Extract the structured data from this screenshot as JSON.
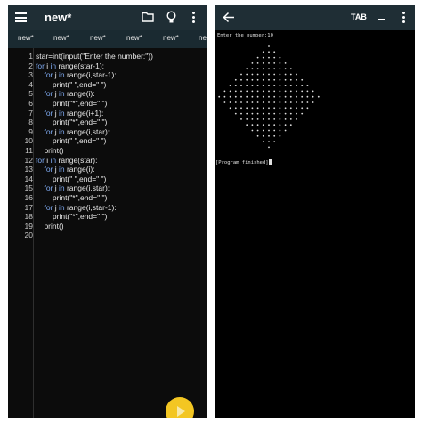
{
  "editor": {
    "title": "new*",
    "tabs": [
      "new*",
      "new*",
      "new*",
      "new*",
      "new*",
      "ne"
    ],
    "line_numbers": [
      "1",
      "2",
      "3",
      "4",
      "5",
      "6",
      "7",
      "8",
      "9",
      "10",
      "11",
      "12",
      "13",
      "14",
      "15",
      "16",
      "17",
      "18",
      "19",
      "20"
    ],
    "code_lines": [
      {
        "segs": [
          {
            "t": "star=int(input(\"Enter the number:\"))"
          }
        ]
      },
      {
        "segs": [
          {
            "t": "for ",
            "k": 1
          },
          {
            "t": "i "
          },
          {
            "t": "in ",
            "k": 1
          },
          {
            "t": "range(star-1):"
          }
        ]
      },
      {
        "segs": [
          {
            "t": "    "
          },
          {
            "t": "for ",
            "k": 1
          },
          {
            "t": "j "
          },
          {
            "t": "in ",
            "k": 1
          },
          {
            "t": "range(i,star-1):"
          }
        ]
      },
      {
        "segs": [
          {
            "t": "        print(\" \",end=\" \")"
          }
        ]
      },
      {
        "segs": [
          {
            "t": "    "
          },
          {
            "t": "for ",
            "k": 1
          },
          {
            "t": "j "
          },
          {
            "t": "in ",
            "k": 1
          },
          {
            "t": "range(i):"
          }
        ]
      },
      {
        "segs": [
          {
            "t": "        print(\"*\",end=\" \")"
          }
        ]
      },
      {
        "segs": [
          {
            "t": "    "
          },
          {
            "t": "for ",
            "k": 1
          },
          {
            "t": "j "
          },
          {
            "t": "in ",
            "k": 1
          },
          {
            "t": "range(i+1):"
          }
        ]
      },
      {
        "segs": [
          {
            "t": "        print(\"*\",end=\" \")"
          }
        ]
      },
      {
        "segs": [
          {
            "t": "    "
          },
          {
            "t": "for ",
            "k": 1
          },
          {
            "t": "j "
          },
          {
            "t": "in ",
            "k": 1
          },
          {
            "t": "range(i,star):"
          }
        ]
      },
      {
        "segs": [
          {
            "t": "        print(\" \",end=\" \")"
          }
        ]
      },
      {
        "segs": [
          {
            "t": "    print()"
          }
        ]
      },
      {
        "segs": [
          {
            "t": "for ",
            "k": 1
          },
          {
            "t": "i "
          },
          {
            "t": "in ",
            "k": 1
          },
          {
            "t": "range(star):"
          }
        ]
      },
      {
        "segs": [
          {
            "t": "    "
          },
          {
            "t": "for ",
            "k": 1
          },
          {
            "t": "j "
          },
          {
            "t": "in ",
            "k": 1
          },
          {
            "t": "range(i):"
          }
        ]
      },
      {
        "segs": [
          {
            "t": "        print(\" \",end=\" \")"
          }
        ]
      },
      {
        "segs": [
          {
            "t": "    "
          },
          {
            "t": "for ",
            "k": 1
          },
          {
            "t": "j "
          },
          {
            "t": "in ",
            "k": 1
          },
          {
            "t": "range(i,star):"
          }
        ]
      },
      {
        "segs": [
          {
            "t": "        print(\"*\",end=\" \")"
          }
        ]
      },
      {
        "segs": [
          {
            "t": "    "
          },
          {
            "t": "for ",
            "k": 1
          },
          {
            "t": "j "
          },
          {
            "t": "in ",
            "k": 1
          },
          {
            "t": "range(i,star-1):"
          }
        ]
      },
      {
        "segs": [
          {
            "t": "        print(\"*\",end=\" \")"
          }
        ]
      },
      {
        "segs": [
          {
            "t": "    print()"
          }
        ]
      },
      {
        "segs": [
          {
            "t": ""
          }
        ]
      }
    ],
    "colors": {
      "keyword": "#7ea9f0",
      "text": "#e8e8e8",
      "fab": "#f3c622",
      "appbar": "#1f2e35"
    }
  },
  "terminal": {
    "tab_label": "TAB",
    "dash_label": "_",
    "prompt": "Enter the number:10",
    "star_count": 10,
    "finished": "[Program finished]"
  }
}
